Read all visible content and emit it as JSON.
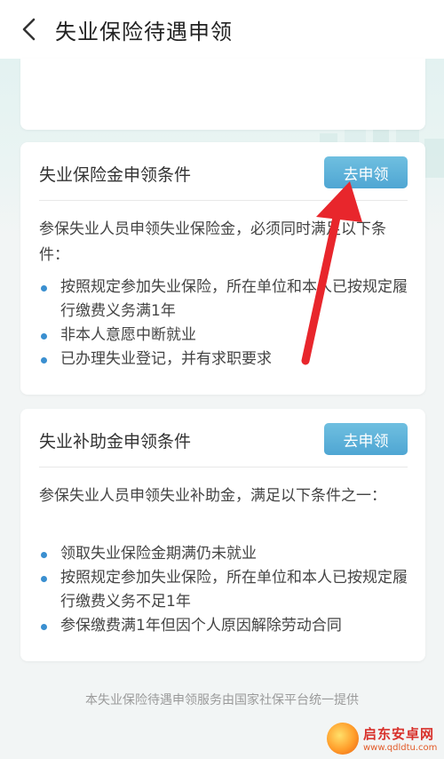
{
  "header": {
    "title": "失业保险待遇申领"
  },
  "cards": [
    {
      "title": "失业保险金申领条件",
      "button": "去申领",
      "description": "参保失业人员申领失业保险金，必须同时满足以下条件：",
      "bullets": [
        "按照规定参加失业保险，所在单位和本人已按规定履行缴费义务满1年",
        "非本人意愿中断就业",
        "已办理失业登记，并有求职要求"
      ]
    },
    {
      "title": "失业补助金申领条件",
      "button": "去申领",
      "description": "参保失业人员申领失业补助金，满足以下条件之一：",
      "bullets": [
        "领取失业保险金期满仍未就业",
        "按照规定参加失业保险，所在单位和本人已按规定履行缴费义务不足1年",
        "参保缴费满1年但因个人原因解除劳动合同"
      ]
    }
  ],
  "footer": {
    "note": "本失业保险待遇申领服务由国家社保平台统一提供"
  },
  "watermark": {
    "name": "启东安卓网",
    "url": "www.qdldtu.com"
  },
  "colors": {
    "button": "#5aaed8",
    "bullet": "#3a8fd0",
    "arrow": "#e8262c"
  }
}
